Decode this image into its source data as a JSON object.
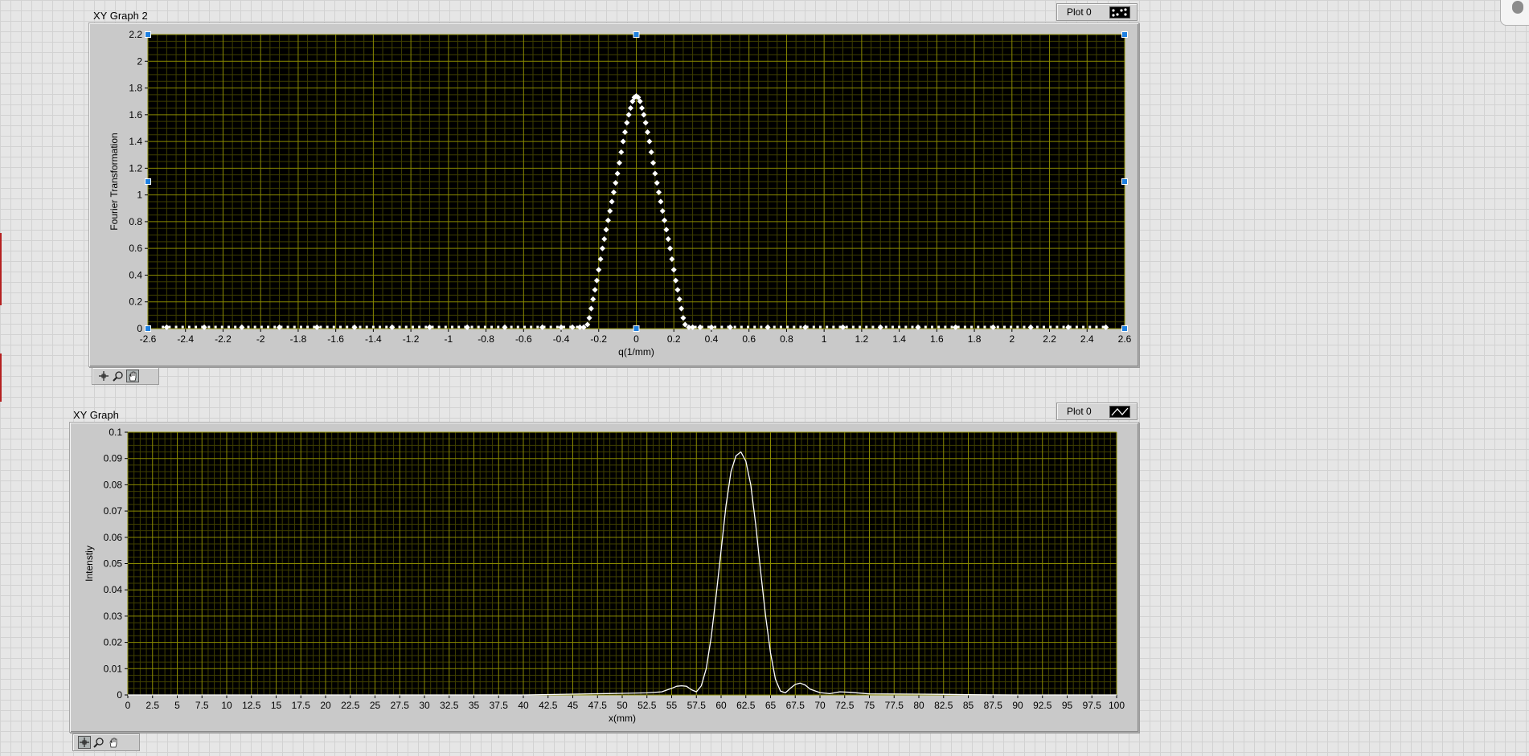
{
  "graphs": [
    {
      "label": "XY Graph 2",
      "legend_label": "Plot 0",
      "legend_icon": "scatter-plot-icon",
      "xlabel": "q(1/mm)",
      "ylabel": "Fourier  Transformation",
      "palette_icons": [
        "cursor-crosshair-icon",
        "zoom-icon",
        "pan-hand-icon"
      ]
    },
    {
      "label": "XY Graph",
      "legend_label": "Plot 0",
      "legend_icon": "line-plot-icon",
      "xlabel": "x(mm)",
      "ylabel": "Intenstiy",
      "palette_icons": [
        "cursor-crosshair-icon",
        "zoom-icon",
        "pan-hand-icon"
      ]
    }
  ],
  "colors": {
    "plot_bg": "#000000",
    "grid_major": "#8a8a00",
    "grid_minor": "#3f3f00",
    "trace": "#ffffff",
    "selection_handle": "#1e7fe0"
  },
  "chart_data": [
    {
      "type": "scatter",
      "title": "XY Graph 2",
      "xlabel": "q(1/mm)",
      "ylabel": "Fourier  Transformation",
      "xlim": [
        -2.6,
        2.6
      ],
      "ylim": [
        0,
        2.2
      ],
      "x_ticks": [
        "-2.6",
        "-2.4",
        "-2.2",
        "-2",
        "-1.8",
        "-1.6",
        "-1.4",
        "-1.2",
        "-1",
        "-0.8",
        "-0.6",
        "-0.4",
        "-0.2",
        "0",
        "0.2",
        "0.4",
        "0.6",
        "0.8",
        "1",
        "1.2",
        "1.4",
        "1.6",
        "1.8",
        "2",
        "2.2",
        "2.4",
        "2.6"
      ],
      "y_ticks": [
        "0",
        "0.2",
        "0.4",
        "0.6",
        "0.8",
        "1",
        "1.2",
        "1.4",
        "1.6",
        "1.8",
        "2",
        "2.2"
      ],
      "grid": true,
      "series": [
        {
          "x": [
            -2.5,
            -2.3,
            -2.1,
            -1.9,
            -1.7,
            -1.5,
            -1.3,
            -1.1,
            -0.9,
            -0.7,
            -0.5,
            -0.4,
            -0.34,
            -0.3,
            -0.28,
            -0.26,
            -0.25,
            -0.24,
            -0.23,
            -0.22,
            -0.21,
            -0.2,
            -0.19,
            -0.18,
            -0.17,
            -0.16,
            -0.15,
            -0.14,
            -0.13,
            -0.12,
            -0.11,
            -0.1,
            -0.09,
            -0.08,
            -0.07,
            -0.06,
            -0.05,
            -0.04,
            -0.03,
            -0.02,
            -0.01,
            0,
            0.01,
            0.02,
            0.03,
            0.04,
            0.05,
            0.06,
            0.07,
            0.08,
            0.09,
            0.1,
            0.11,
            0.12,
            0.13,
            0.14,
            0.15,
            0.16,
            0.17,
            0.18,
            0.19,
            0.2,
            0.21,
            0.22,
            0.23,
            0.24,
            0.25,
            0.26,
            0.28,
            0.3,
            0.34,
            0.4,
            0.5,
            0.7,
            0.9,
            1.1,
            1.3,
            1.5,
            1.7,
            1.9,
            2.1,
            2.3,
            2.5
          ],
          "y": [
            0.01,
            0.01,
            0.01,
            0.01,
            0.01,
            0.01,
            0.01,
            0.01,
            0.01,
            0.01,
            0.01,
            0.01,
            0.01,
            0.01,
            0.01,
            0.03,
            0.08,
            0.15,
            0.22,
            0.29,
            0.36,
            0.44,
            0.52,
            0.6,
            0.67,
            0.74,
            0.81,
            0.88,
            0.95,
            1.02,
            1.09,
            1.16,
            1.24,
            1.32,
            1.4,
            1.47,
            1.54,
            1.6,
            1.65,
            1.7,
            1.73,
            1.74,
            1.73,
            1.7,
            1.65,
            1.6,
            1.54,
            1.47,
            1.4,
            1.32,
            1.24,
            1.16,
            1.09,
            1.02,
            0.95,
            0.88,
            0.81,
            0.74,
            0.67,
            0.6,
            0.52,
            0.44,
            0.36,
            0.29,
            0.22,
            0.15,
            0.08,
            0.03,
            0.01,
            0.01,
            0.01,
            0.01,
            0.01,
            0.01,
            0.01,
            0.01,
            0.01,
            0.01,
            0.01,
            0.01,
            0.01,
            0.01,
            0.01
          ]
        }
      ]
    },
    {
      "type": "line",
      "title": "XY Graph",
      "xlabel": "x(mm)",
      "ylabel": "Intenstiy",
      "xlim": [
        0,
        100
      ],
      "ylim": [
        0,
        0.1
      ],
      "x_ticks": [
        "0",
        "2.5",
        "5",
        "7.5",
        "10",
        "12.5",
        "15",
        "17.5",
        "20",
        "22.5",
        "25",
        "27.5",
        "30",
        "32.5",
        "35",
        "37.5",
        "40",
        "42.5",
        "45",
        "47.5",
        "50",
        "52.5",
        "55",
        "57.5",
        "60",
        "62.5",
        "65",
        "67.5",
        "70",
        "72.5",
        "75",
        "77.5",
        "80",
        "82.5",
        "85",
        "87.5",
        "90",
        "92.5",
        "95",
        "97.5",
        "100"
      ],
      "y_ticks": [
        "0",
        "0.01",
        "0.02",
        "0.03",
        "0.04",
        "0.05",
        "0.06",
        "0.07",
        "0.08",
        "0.09",
        "0.1"
      ],
      "grid": true,
      "series": [
        {
          "x": [
            0,
            40,
            45,
            50,
            52.5,
            54,
            55,
            55.5,
            56,
            56.5,
            57,
            57.5,
            58,
            58.5,
            59,
            59.5,
            60,
            60.5,
            61,
            61.5,
            62,
            62.5,
            63,
            63.5,
            64,
            64.5,
            65,
            65.5,
            66,
            66.5,
            67,
            67.5,
            68,
            68.5,
            69,
            70,
            71,
            72,
            73,
            75,
            80,
            83,
            85,
            90,
            100
          ],
          "y": [
            0,
            0,
            0.0003,
            0.0006,
            0.0008,
            0.0012,
            0.0025,
            0.0033,
            0.0035,
            0.0033,
            0.002,
            0.0012,
            0.0035,
            0.01,
            0.022,
            0.038,
            0.055,
            0.072,
            0.085,
            0.091,
            0.0925,
            0.089,
            0.08,
            0.065,
            0.047,
            0.03,
            0.016,
            0.006,
            0.0015,
            0.0008,
            0.0025,
            0.004,
            0.0045,
            0.0038,
            0.0022,
            0.0009,
            0.0005,
            0.0012,
            0.001,
            0.0004,
            0.0003,
            0.0002,
            0.0001,
            0,
            0
          ]
        }
      ]
    }
  ]
}
